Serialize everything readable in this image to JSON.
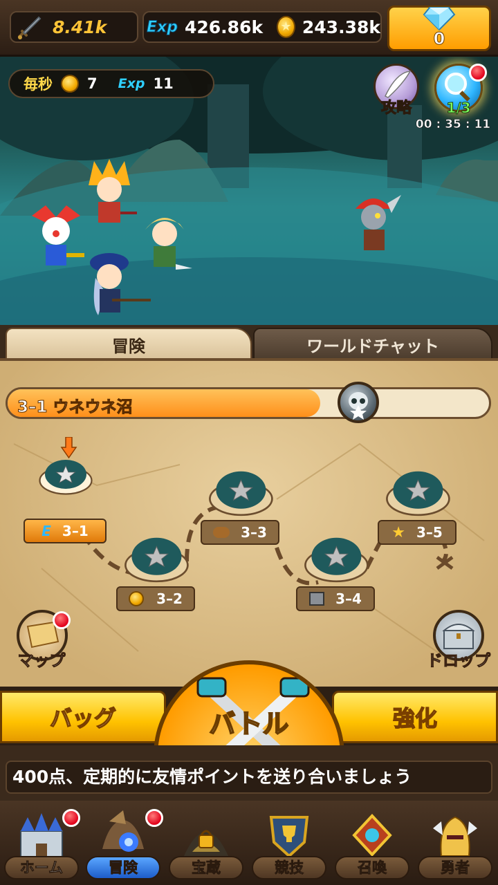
{
  "top_bar": {
    "power_value": "8.41k",
    "exp_label": "Exp",
    "exp_value": "426.86k",
    "gold_value": "243.38k",
    "gem_value": "0"
  },
  "scene": {
    "rate_label": "毎秒",
    "rate_gold": "7",
    "rate_exp_label": "Exp",
    "rate_exp": "11",
    "guide_label": "攻略",
    "quest_count": "1/3",
    "quest_timer": "00 : 35 : 11"
  },
  "tabs": [
    {
      "label": "冒険",
      "active": true
    },
    {
      "label": "ワールドチャット",
      "active": false
    }
  ],
  "stage": {
    "title": "3–1  ウネウネ沼",
    "progress": 0.65
  },
  "nodes": [
    {
      "label": "3–1",
      "badge": "E",
      "current": true
    },
    {
      "label": "3–2",
      "badge": "coin"
    },
    {
      "label": "3–3",
      "badge": "bread"
    },
    {
      "label": "3–4",
      "badge": "box"
    },
    {
      "label": "3–5",
      "badge": "star"
    }
  ],
  "map_buttons": {
    "map_label": "マップ",
    "drop_label": "ドロップ"
  },
  "actions": {
    "bag_label": "バッグ",
    "battle_label": "バトル",
    "upgrade_label": "強化"
  },
  "ticker": {
    "text": "400点、定期的に友情ポイントを送り合いましょう"
  },
  "nav": [
    {
      "label": "ホーム",
      "icon": "castle-icon",
      "badge": true
    },
    {
      "label": "冒険",
      "icon": "dragon-icon",
      "badge": true,
      "active": true
    },
    {
      "label": "宝蔵",
      "icon": "treasure-lock-icon",
      "badge": false
    },
    {
      "label": "競技",
      "icon": "trophy-shield-icon",
      "badge": false
    },
    {
      "label": "召喚",
      "icon": "summon-tome-icon",
      "badge": false
    },
    {
      "label": "勇者",
      "icon": "knight-helmet-icon",
      "badge": false
    }
  ],
  "colors": {
    "accent": "#ffc200",
    "badge": "#e2001a",
    "panel": "#cfae74"
  }
}
